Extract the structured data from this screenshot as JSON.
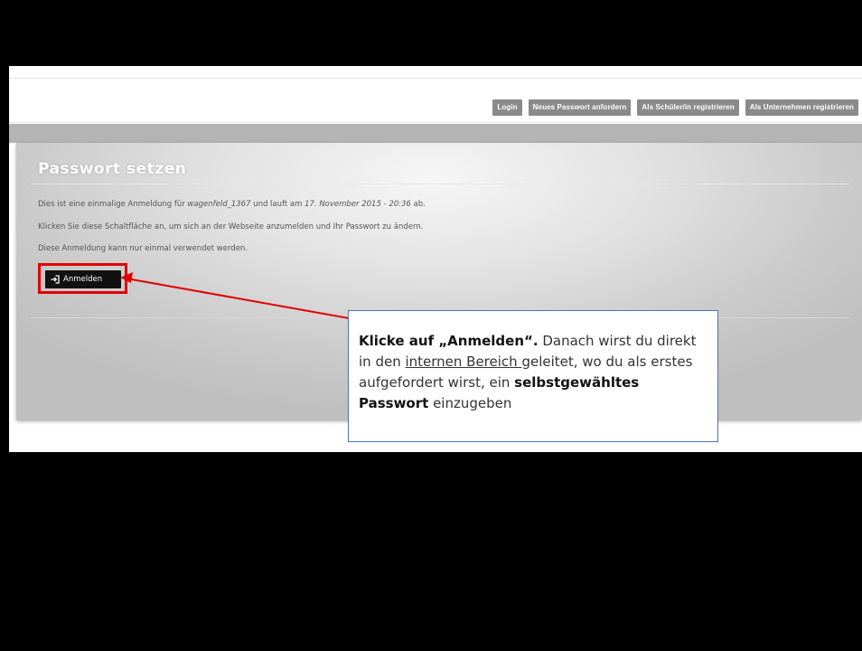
{
  "nav": {
    "login": "Login",
    "new_password": "Neues Passwort anfordern",
    "register_student": "Als Schüler/in registrieren",
    "register_company": "Als Unternehmen registrieren"
  },
  "page": {
    "title": "Passwort setzen",
    "line1_prefix": "Dies ist eine einmalige Anmeldung für ",
    "line1_user": "wagenfeld_1367",
    "line1_mid": " und lauft am ",
    "line1_date": "17. November 2015 - 20:36",
    "line1_suffix": " ab.",
    "line2": "Klicken Sie diese Schaltfläche an, um sich an der Webseite anzumelden und Ihr Passwort zu ändern.",
    "line3": "Diese Anmeldung kann nur einmal verwendet werden.",
    "login_button": "Anmelden"
  },
  "callout": {
    "bold1": "Klicke auf „Anmelden“.",
    "t1": " Danach wirst du direkt in den ",
    "underline": "internen Bereich ",
    "t2": "geleitet, wo du als erstes aufgefordert wirst, ein ",
    "bold2": "selbstgewähltes Passwort",
    "t3": " einzugeben"
  },
  "colors": {
    "highlight": "#e10000",
    "callout_border": "#4f74b3",
    "nav_button": "#8a8a8a",
    "login_button": "#111111"
  },
  "icons": {
    "login_button": "sign-in-icon"
  }
}
